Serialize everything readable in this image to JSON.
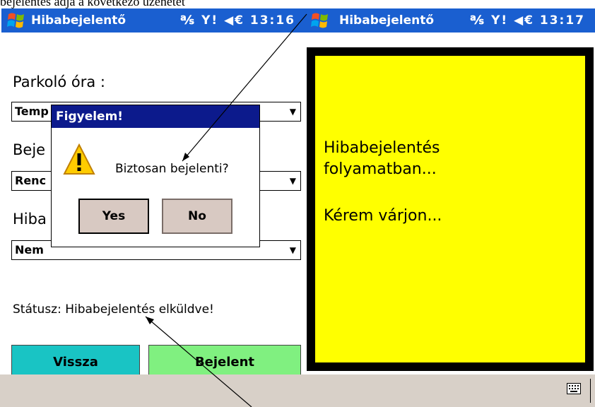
{
  "caption": "bejelentés adja a következő üzenetet",
  "left_screen": {
    "title": "Hibabejelentő",
    "status_icons": "℁ Y! ◀€ 13:16",
    "parking_label": "Parkoló óra :",
    "parking_value": "Temp",
    "report_label_partial": "Beje",
    "report_value": "Renc",
    "error_label_partial": "Hiba",
    "error_value": "Nem",
    "status_text": "Státusz: Hibabejelentés elküldve!",
    "back_label": "Vissza",
    "report_button_label": "Bejelent"
  },
  "dialog": {
    "title": "Figyelem!",
    "message": "Biztosan bejelenti?",
    "yes_label": "Yes",
    "no_label": "No"
  },
  "right_screen": {
    "title": "Hibabejelentő",
    "status_icons": "℁ Y! ◀€ 13:17",
    "line1": "Hibabejelentés",
    "line2": "folyamatban...",
    "line3": "Kérem várjon..."
  },
  "colors": {
    "titlebar": "#1a5fd0",
    "dialog_title": "#0c1a8c",
    "back_button": "#19c4c4",
    "report_button": "#80f080",
    "panel": "#ffff00"
  }
}
